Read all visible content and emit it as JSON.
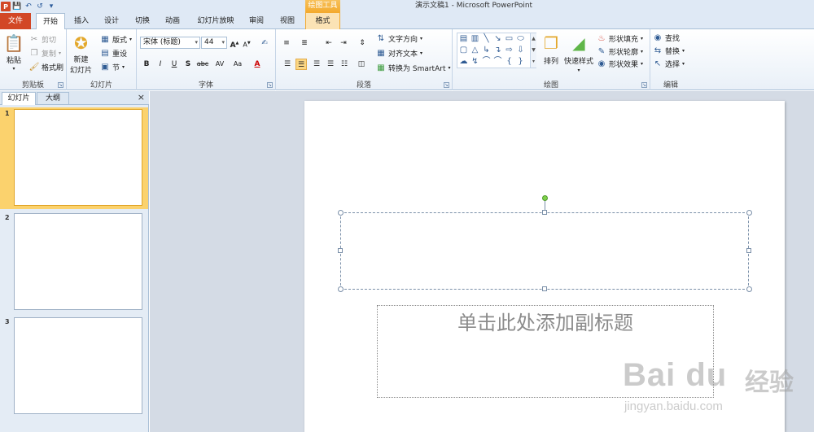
{
  "window": {
    "title": "演示文稿1 - Microsoft PowerPoint",
    "context_tool_header": "绘图工具"
  },
  "quick_access": {
    "app_logo": "P",
    "icons": [
      "save-icon",
      "undo-icon",
      "redo-icon",
      "customize-icon"
    ]
  },
  "tabs": [
    {
      "label": "文件"
    },
    {
      "label": "开始"
    },
    {
      "label": "插入"
    },
    {
      "label": "设计"
    },
    {
      "label": "切换"
    },
    {
      "label": "动画"
    },
    {
      "label": "幻灯片放映"
    },
    {
      "label": "审阅"
    },
    {
      "label": "视图"
    },
    {
      "label": "格式"
    }
  ],
  "ribbon": {
    "clipboard": {
      "label": "剪贴板",
      "paste": "粘贴",
      "cut": "剪切",
      "copy": "复制",
      "format_painter": "格式刷"
    },
    "slides": {
      "label": "幻灯片",
      "new_slide_line1": "新建",
      "new_slide_line2": "幻灯片",
      "layout": "版式",
      "reset": "重设",
      "section": "节"
    },
    "font": {
      "label": "字体",
      "font_name": "宋体 (标题)",
      "font_size": "44",
      "bold": "B",
      "italic": "I",
      "underline": "U",
      "shadow": "S",
      "strike": "abc",
      "spacing": "AV",
      "case": "Aa",
      "color": "A",
      "grow": "A",
      "shrink": "A"
    },
    "paragraph": {
      "label": "段落",
      "text_direction": "文字方向",
      "align_text": "对齐文本",
      "smartart": "转换为 SmartArt"
    },
    "drawing": {
      "label": "绘图",
      "arrange": "排列",
      "quick_styles": "快速样式",
      "shape_fill": "形状填充",
      "shape_outline": "形状轮廓",
      "shape_effects": "形状效果"
    },
    "editing": {
      "label": "编辑",
      "find": "查找",
      "replace": "替换",
      "select": "选择"
    }
  },
  "left_pane": {
    "tabs": [
      "幻灯片",
      "大纲"
    ],
    "close": "×",
    "thumbnails": [
      {
        "num": "1",
        "selected": true
      },
      {
        "num": "2",
        "selected": false
      },
      {
        "num": "3",
        "selected": false
      }
    ]
  },
  "slide": {
    "subtitle_placeholder": "单击此处添加副标题"
  },
  "watermark": {
    "brand": "Bai du",
    "brand_cn": "经验",
    "url": "jingyan.baidu.com"
  }
}
